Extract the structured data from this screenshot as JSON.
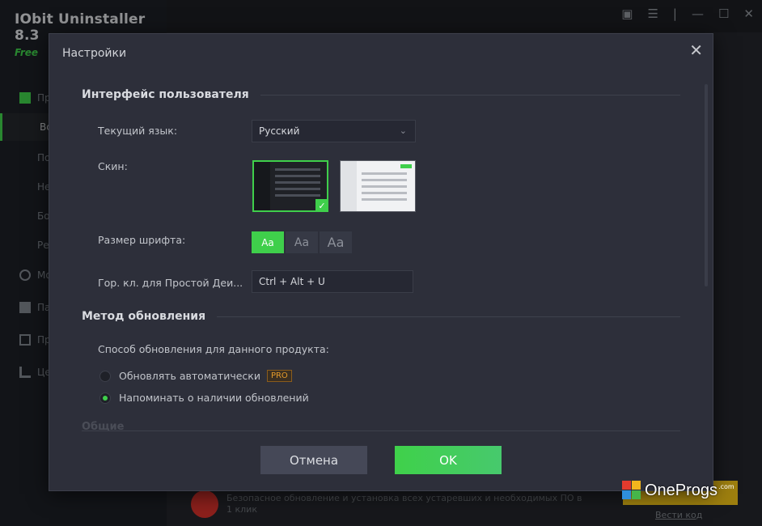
{
  "app": {
    "name": "IObit Uninstaller 8.3",
    "edition": "Free",
    "accent": "#3fcf4b"
  },
  "sidebar": {
    "items": [
      {
        "label": "Пр",
        "icon": "apps-icon"
      },
      {
        "label": "Вс"
      },
      {
        "label": "По"
      },
      {
        "label": "Не"
      },
      {
        "label": "Бо"
      },
      {
        "label": "Ре"
      },
      {
        "label": "Мо",
        "icon": "browser-icon"
      },
      {
        "label": "Па",
        "icon": "plugin-icon"
      },
      {
        "label": "Пр",
        "icon": "windows-icon"
      },
      {
        "label": "Це",
        "icon": "action-center-icon"
      }
    ]
  },
  "promo": {
    "text": "Безопасное обновление и установка всех устаревших и необходимых ПО в 1 клик",
    "link": "Вести код"
  },
  "dialog": {
    "title": "Настройки",
    "sections": {
      "ui": {
        "heading": "Интерфейс пользователя",
        "language_label": "Текущий язык:",
        "language_value": "Русский",
        "skin_label": "Скин:",
        "font_label": "Размер шрифта:",
        "font_options": [
          "Aa",
          "Aa",
          "Aa"
        ],
        "hotkey_label": "Гор. кл. для Простой Деи...",
        "hotkey_value": "Ctrl + Alt + U"
      },
      "update": {
        "heading": "Метод обновления",
        "subtitle": "Способ обновления для данного продукта:",
        "option_auto": "Обновлять автоматически",
        "pro_badge": "PRO",
        "option_notify": "Напоминать о наличии обновлений"
      },
      "next": {
        "heading": "Общие"
      }
    },
    "buttons": {
      "cancel": "Отмена",
      "ok": "OK"
    }
  },
  "watermark": {
    "text": "OneProgs",
    "suffix": ".com"
  }
}
